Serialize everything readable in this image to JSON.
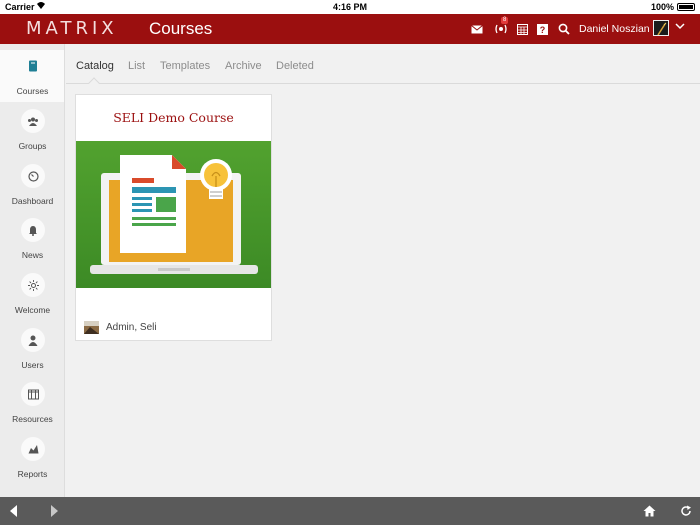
{
  "status_bar": {
    "carrier": "Carrier",
    "time": "4:16 PM",
    "battery": "100%"
  },
  "header": {
    "logo": "MATRIX",
    "title": "Courses",
    "notification_count": "8",
    "user_name": "Daniel Noszian",
    "bg_color": "#9b0f0f"
  },
  "sidebar": {
    "items": [
      {
        "label": "Courses",
        "icon": "book-icon"
      },
      {
        "label": "Groups",
        "icon": "groups-icon"
      },
      {
        "label": "Dashboard",
        "icon": "dashboard-icon"
      },
      {
        "label": "News",
        "icon": "bell-icon"
      },
      {
        "label": "Welcome",
        "icon": "sun-icon"
      },
      {
        "label": "Users",
        "icon": "user-icon"
      },
      {
        "label": "Resources",
        "icon": "resources-icon"
      },
      {
        "label": "Reports",
        "icon": "reports-icon"
      }
    ]
  },
  "tabs": [
    {
      "label": "Catalog",
      "active": true
    },
    {
      "label": "List"
    },
    {
      "label": "Templates"
    },
    {
      "label": "Archive"
    },
    {
      "label": "Deleted"
    }
  ],
  "course_card": {
    "title": "SELI Demo Course",
    "author": "Admin, Seli"
  }
}
